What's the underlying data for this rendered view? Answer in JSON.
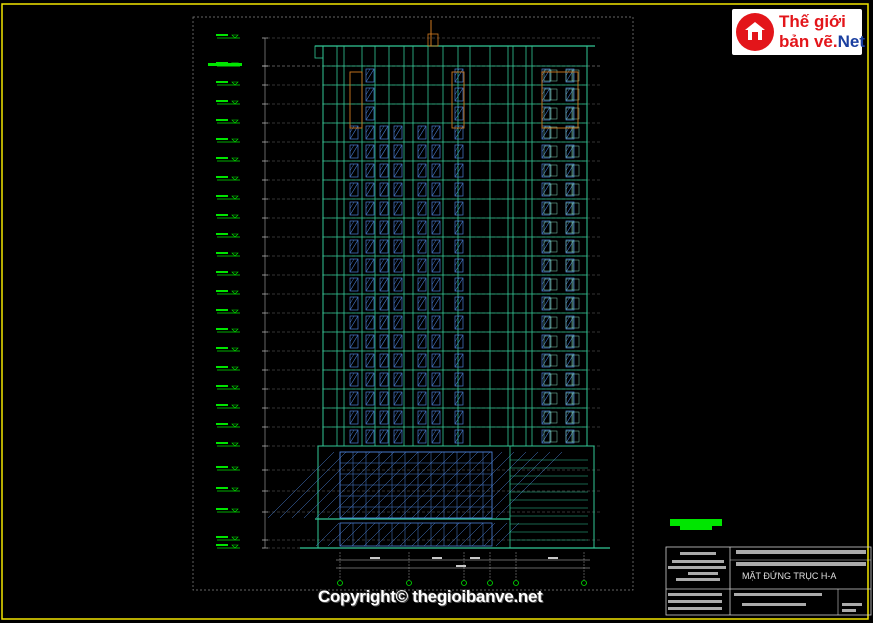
{
  "logo": {
    "line1": "Thế giới",
    "line2a": "bản vẽ.",
    "line2b": "Net"
  },
  "copyright": "Copyright© thegioibanve.net",
  "title_block": {
    "drawing_title": "MẶT ĐỨNG TRỤC H-A"
  },
  "colors": {
    "frame": "#f2e600",
    "structure": "#32c896",
    "glass": "#4a7fd4",
    "level_mark": "#00e600",
    "dim": "#c8c8c8"
  },
  "drawing": {
    "floors_above_podium": 20,
    "grid_axes": 6,
    "view": "elevation"
  }
}
